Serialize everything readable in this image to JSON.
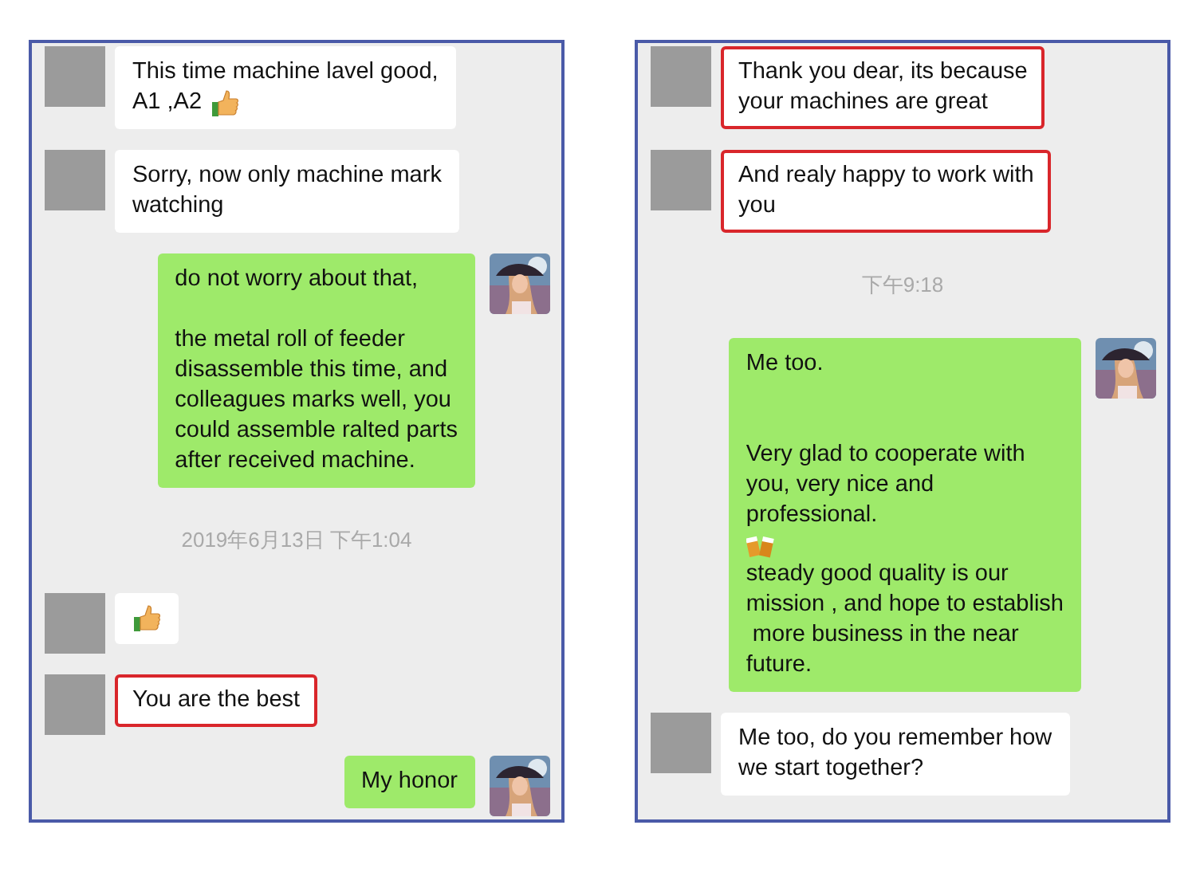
{
  "panels": [
    {
      "messages": [
        {
          "kind": "in",
          "highlighted": false,
          "parts": [
            {
              "kind": "text",
              "text": "This time machine lavel good,"
            },
            {
              "kind": "text",
              "text": "A1 ,A2"
            },
            {
              "kind": "thumbs"
            }
          ]
        },
        {
          "kind": "in",
          "highlighted": false,
          "parts": [
            {
              "kind": "text",
              "text": "Sorry, now only machine mark\nwatching"
            }
          ]
        },
        {
          "kind": "out",
          "highlighted": false,
          "parts": [
            {
              "kind": "text",
              "text": "do not worry about that,\n\nthe metal roll of feeder\ndisassemble this time, and\ncolleagues marks well, you\ncould assemble ralted parts\nafter received machine."
            }
          ]
        },
        {
          "kind": "time",
          "text": "2019年6月13日 下午1:04"
        },
        {
          "kind": "in",
          "highlighted": false,
          "parts": [
            {
              "kind": "thumbs"
            }
          ]
        },
        {
          "kind": "in",
          "highlighted": true,
          "parts": [
            {
              "kind": "text",
              "text": "You are the best"
            }
          ]
        },
        {
          "kind": "out",
          "highlighted": false,
          "parts": [
            {
              "kind": "text",
              "text": "My honor"
            }
          ]
        }
      ]
    },
    {
      "messages": [
        {
          "kind": "in",
          "highlighted": true,
          "parts": [
            {
              "kind": "text",
              "text": "Thank you dear, its because\nyour machines are great"
            }
          ]
        },
        {
          "kind": "in",
          "highlighted": true,
          "parts": [
            {
              "kind": "text",
              "text": "And realy happy to work with\nyou"
            }
          ]
        },
        {
          "kind": "time",
          "text": "下午9:18"
        },
        {
          "kind": "out",
          "highlighted": false,
          "parts": [
            {
              "kind": "text",
              "text": "Me too.\n\n\nVery glad to cooperate with\nyou, very nice and\nprofessional."
            },
            {
              "kind": "beer"
            },
            {
              "kind": "text",
              "text": "steady good quality is our\nmission , and hope to establish\n more business in the near\nfuture."
            }
          ]
        },
        {
          "kind": "in",
          "highlighted": false,
          "parts": [
            {
              "kind": "text",
              "text": "Me too, do you remember how\nwe start together?"
            }
          ]
        }
      ]
    }
  ]
}
